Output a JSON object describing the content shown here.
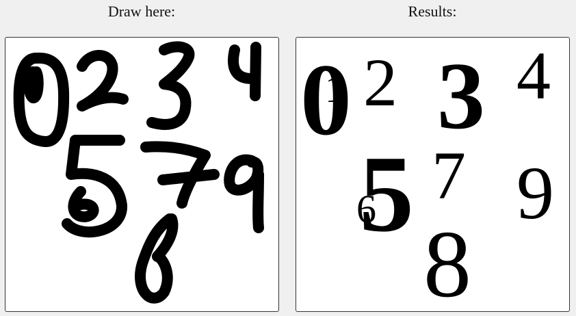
{
  "headers": {
    "draw": "Draw here:",
    "results": "Results:"
  },
  "results": {
    "d0": "0",
    "d1": "1",
    "d2": "2",
    "d3": "3",
    "d4": "4",
    "d5": "5",
    "d6": "6",
    "d7": "7",
    "d8": "8",
    "d9": "9"
  }
}
